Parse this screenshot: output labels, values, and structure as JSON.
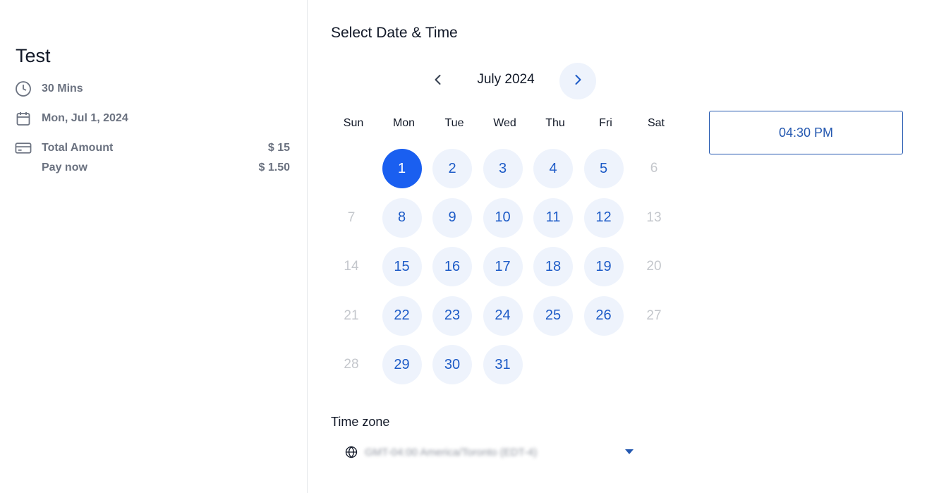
{
  "event": {
    "title": "Test",
    "duration": "30 Mins",
    "date": "Mon, Jul 1, 2024",
    "total_label": "Total Amount",
    "total_value": "$ 15",
    "pay_label": "Pay now",
    "pay_value": "$ 1.50"
  },
  "booking": {
    "heading": "Select Date & Time",
    "month_label": "July 2024",
    "weekdays": [
      "Sun",
      "Mon",
      "Tue",
      "Wed",
      "Thu",
      "Fri",
      "Sat"
    ],
    "days": [
      {
        "label": "1",
        "state": "selected"
      },
      {
        "label": "2",
        "state": "available"
      },
      {
        "label": "3",
        "state": "available"
      },
      {
        "label": "4",
        "state": "available"
      },
      {
        "label": "5",
        "state": "available"
      },
      {
        "label": "6",
        "state": "disabled"
      },
      {
        "label": "7",
        "state": "disabled"
      },
      {
        "label": "8",
        "state": "available"
      },
      {
        "label": "9",
        "state": "available"
      },
      {
        "label": "10",
        "state": "available"
      },
      {
        "label": "11",
        "state": "available"
      },
      {
        "label": "12",
        "state": "available"
      },
      {
        "label": "13",
        "state": "disabled"
      },
      {
        "label": "14",
        "state": "disabled"
      },
      {
        "label": "15",
        "state": "available"
      },
      {
        "label": "16",
        "state": "available"
      },
      {
        "label": "17",
        "state": "available"
      },
      {
        "label": "18",
        "state": "available"
      },
      {
        "label": "19",
        "state": "available"
      },
      {
        "label": "20",
        "state": "disabled"
      },
      {
        "label": "21",
        "state": "disabled"
      },
      {
        "label": "22",
        "state": "available"
      },
      {
        "label": "23",
        "state": "available"
      },
      {
        "label": "24",
        "state": "available"
      },
      {
        "label": "25",
        "state": "available"
      },
      {
        "label": "26",
        "state": "available"
      },
      {
        "label": "27",
        "state": "disabled"
      },
      {
        "label": "28",
        "state": "disabled"
      },
      {
        "label": "29",
        "state": "available"
      },
      {
        "label": "30",
        "state": "available"
      },
      {
        "label": "31",
        "state": "available"
      }
    ],
    "time_slots": [
      "04:30 PM"
    ],
    "timezone_label": "Time zone",
    "timezone_value": "GMT-04:00 America/Toronto (EDT-4)"
  },
  "colors": {
    "accent": "#1a5ff0",
    "available_bg": "#eef3fc",
    "available_text": "#1d5bc7",
    "slot_border": "#2458b0"
  }
}
